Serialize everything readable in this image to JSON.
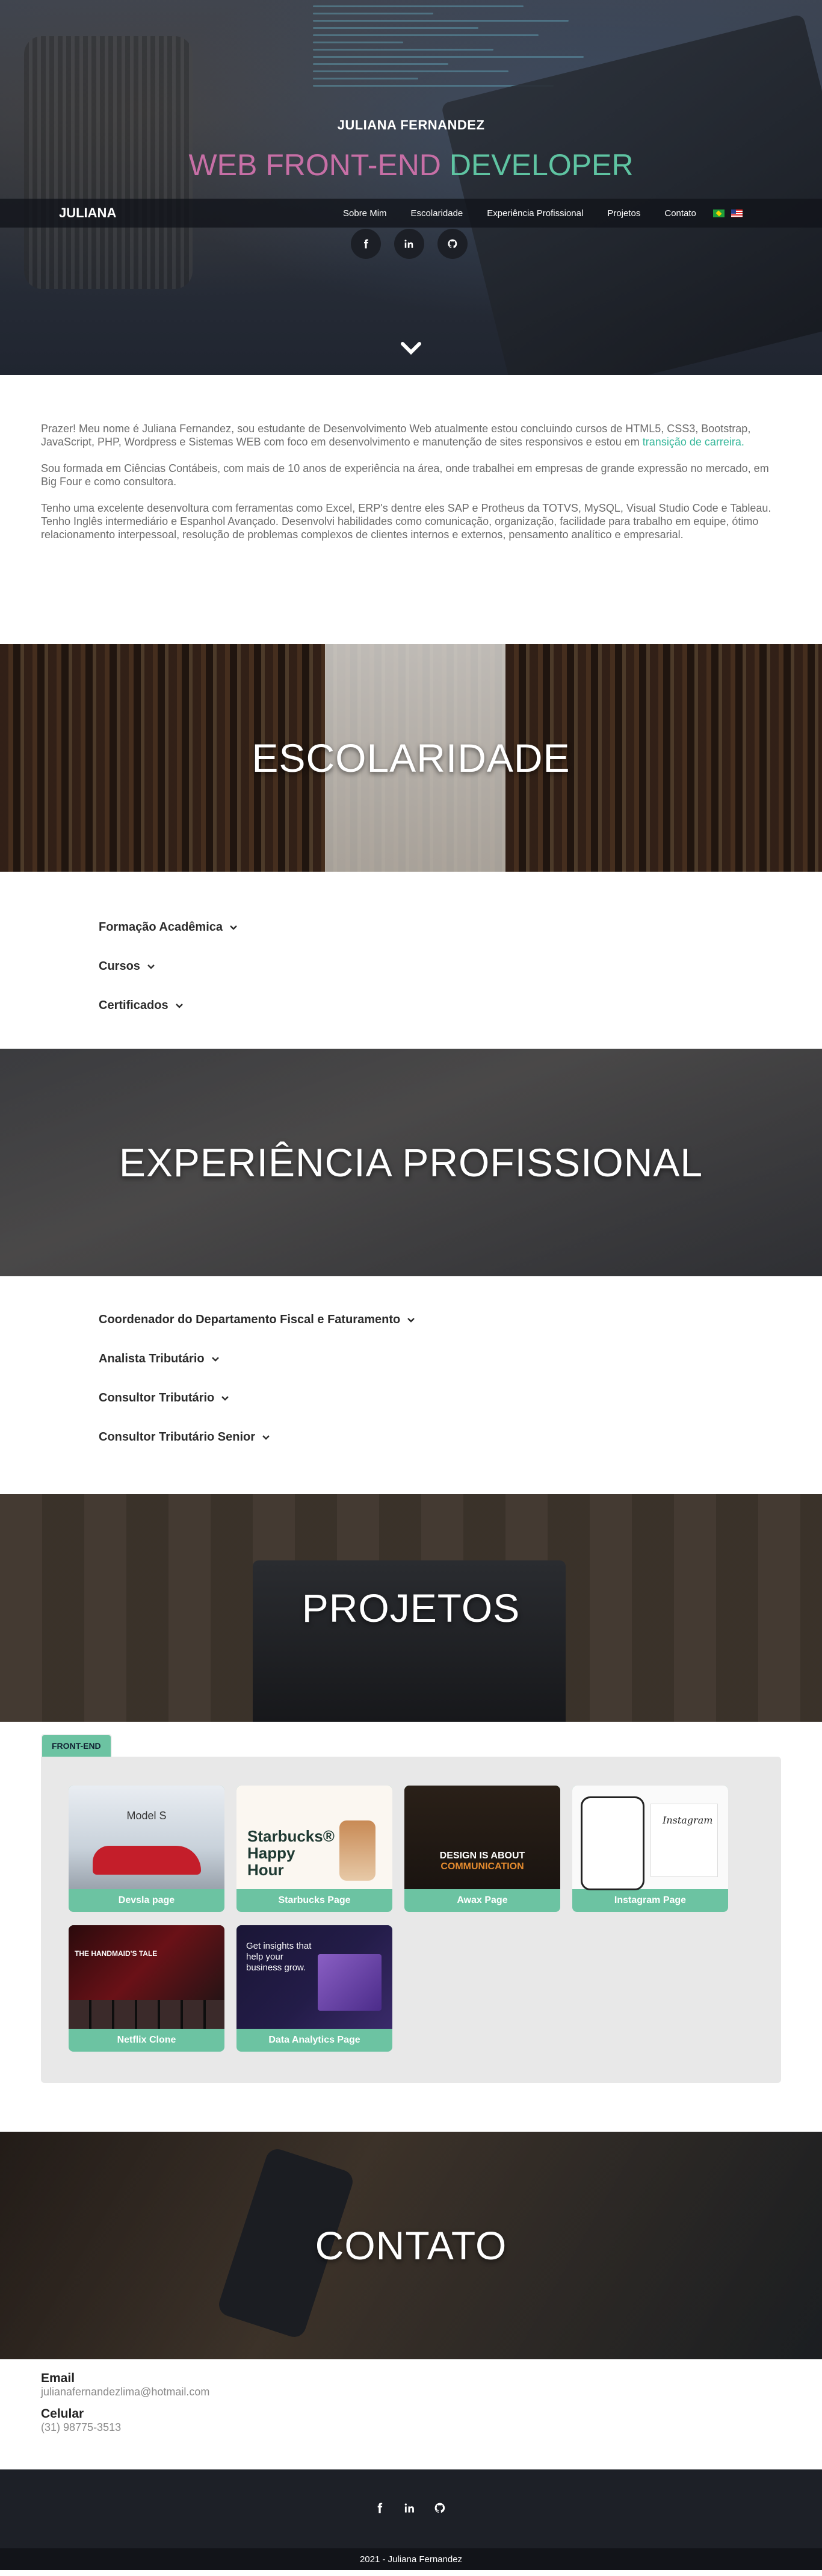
{
  "hero": {
    "name": "JULIANA FERNANDEZ",
    "title_part1": "WEB FRONT-END",
    "title_part2": "DEVELOPER"
  },
  "nav": {
    "brand": "JULIANA",
    "links": [
      "Sobre Mim",
      "Escolaridade",
      "Experiência Profissional",
      "Projetos",
      "Contato"
    ],
    "languages": [
      "brazil-flag-icon",
      "usa-flag-icon"
    ]
  },
  "social_icons": [
    "facebook-icon",
    "linkedin-icon",
    "github-icon"
  ],
  "about": {
    "p1_text": "Prazer! Meu nome é Juliana Fernandez, sou estudante de Desenvolvimento Web atualmente estou concluindo cursos de HTML5, CSS3, Bootstrap, JavaScript, PHP, Wordpress e Sistemas WEB com foco em desenvolvimento e manutenção de sites responsivos e estou em ",
    "p1_highlight": "transição de carreira.",
    "p2": "Sou formada em Ciências Contábeis, com mais de 10 anos de experiência na área, onde trabalhei em empresas de grande expressão no mercado, em Big Four e como consultora.",
    "p3": "Tenho uma excelente desenvoltura com ferramentas como Excel, ERP's dentre eles SAP e Protheus da TOTVS, MySQL, Visual Studio Code e Tableau. Tenho Inglês intermediário e Espanhol Avançado. Desenvolvi habilidades como comunicação, organização, facilidade para trabalho em equipe, ótimo relacionamento interpessoal, resolução de problemas complexos de clientes internos e externos, pensamento analítico e empresarial."
  },
  "sections": {
    "education": "ESCOLARIDADE",
    "experience": "EXPERIÊNCIA PROFISSIONAL",
    "projects": "PROJETOS",
    "contact": "CONTATO"
  },
  "education_items": [
    "Formação Acadêmica",
    "Cursos",
    "Certificados"
  ],
  "experience_items": [
    "Coordenador do Departamento Fiscal e Faturamento",
    "Analista Tributário",
    "Consultor Tributário",
    "Consultor Tributário Senior"
  ],
  "projects": {
    "tab": "FRONT-END",
    "cards": [
      {
        "label": "Devsla page",
        "thumb_text": "Model S"
      },
      {
        "label": "Starbucks Page",
        "thumb_text": "Starbucks® Happy Hour"
      },
      {
        "label": "Awax Page",
        "thumb_text_a": "DESIGN IS ABOUT",
        "thumb_text_b": "COMMUNICATION"
      },
      {
        "label": "Instagram Page",
        "thumb_text": "Instagram"
      },
      {
        "label": "Netflix Clone",
        "thumb_text": "THE HANDMAID'S TALE"
      },
      {
        "label": "Data Analytics Page",
        "thumb_text": "Get insights that help your business grow."
      }
    ]
  },
  "contact": {
    "email_label": "Email",
    "email": "julianafernandezlima@hotmail.com",
    "phone_label": "Celular",
    "phone": "(31) 98775-3513"
  },
  "footer": {
    "copyright": "2021 - Juliana Fernandez"
  },
  "colors": {
    "accent_green": "#5fc4a2",
    "accent_pink": "#c76fa6",
    "footer_bg": "#1d2027"
  }
}
